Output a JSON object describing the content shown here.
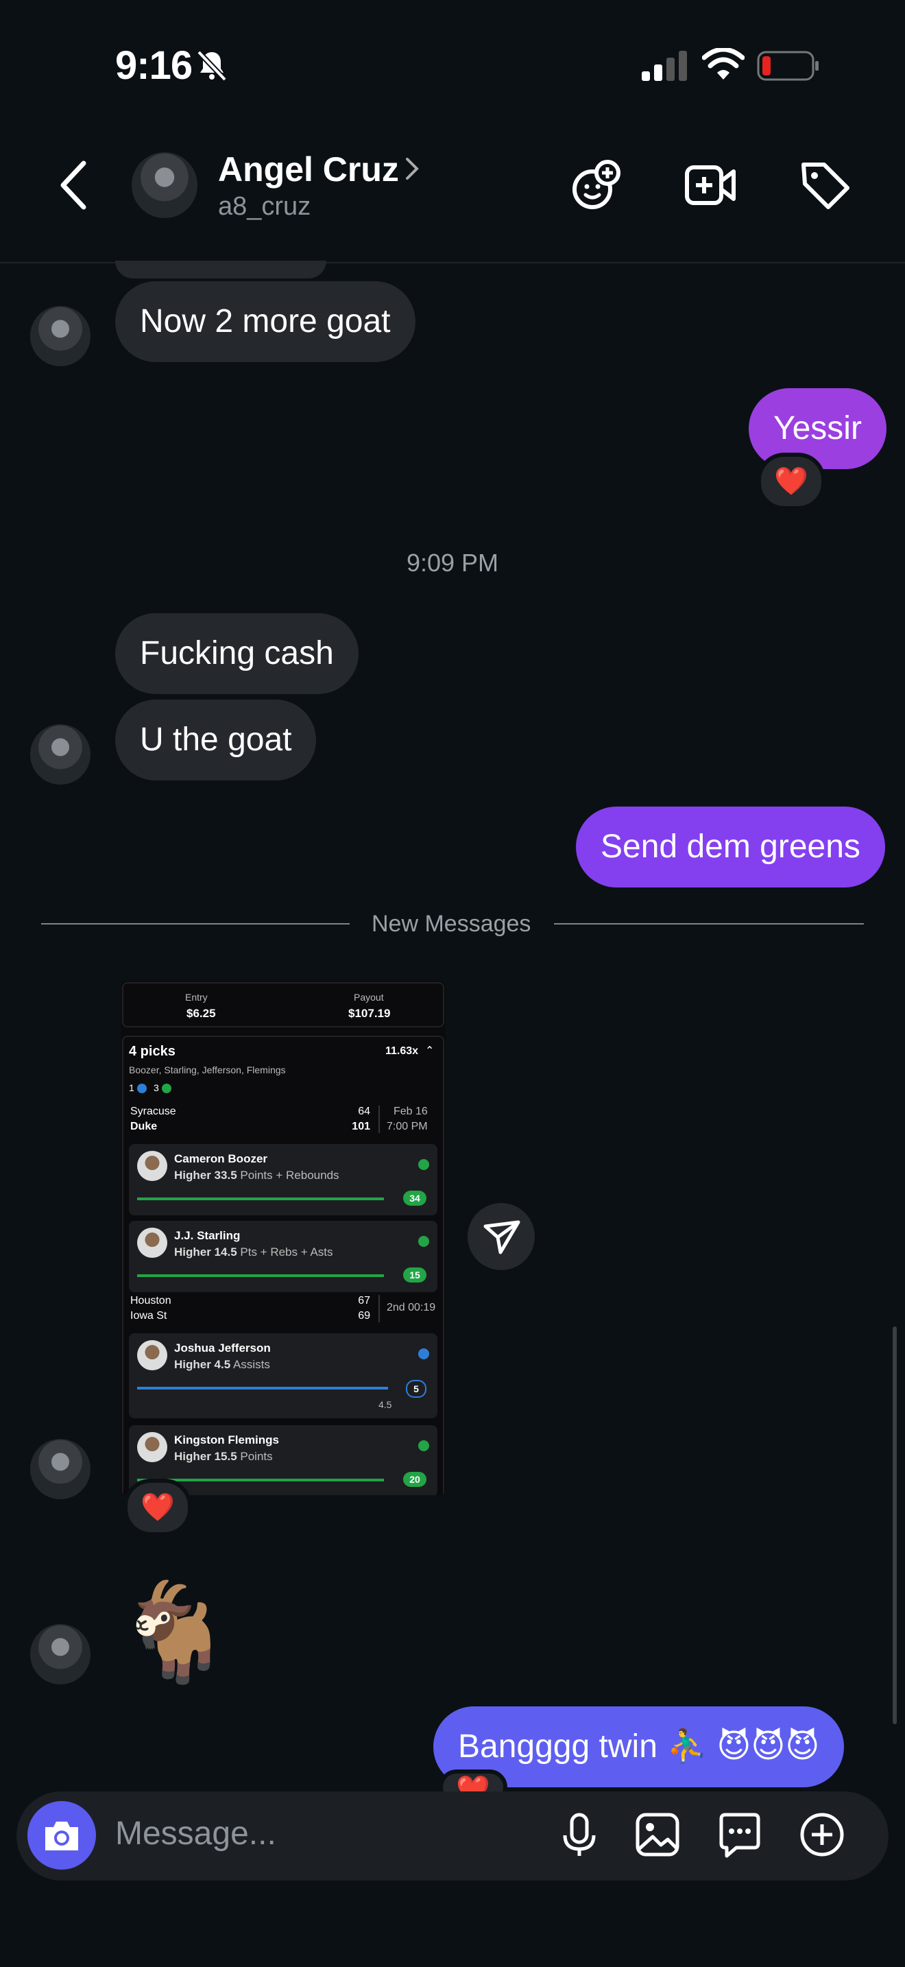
{
  "status": {
    "time": "9:16"
  },
  "header": {
    "name": "Angel Cruz",
    "username": "a8_cruz"
  },
  "messages": {
    "in_1": "Now 2 more goat",
    "out_1": "Yessir",
    "out_1_reaction": "❤️",
    "timestamp": "9:09 PM",
    "in_2": "Fucking cash",
    "in_3": "U the goat",
    "out_2": "Send dem greens",
    "divider": "New Messages",
    "image_reaction": "❤️",
    "in_emoji": "🐐",
    "out_3": "Bangggg twin ⛹️‍♂️ 😈😈😈",
    "out_3_reaction": "❤️"
  },
  "shared_screenshot": {
    "entry_label": "Entry",
    "entry_value": "$6.25",
    "payout_label": "Payout",
    "payout_value": "$107.19",
    "picks_title": "4 picks",
    "multiplier": "11.63x",
    "players_line": "Boozer, Starling, Jefferson, Flemings",
    "status_counts": [
      "1",
      "3"
    ],
    "game1": {
      "team_a": "Syracuse",
      "team_b": "Duke",
      "score_a": "64",
      "score_b": "101",
      "date": "Feb 16",
      "time": "7:00 PM"
    },
    "pick1": {
      "name": "Cameron Boozer",
      "line": "Higher 33.5",
      "stat": "Points + Rebounds",
      "result": "34"
    },
    "pick2": {
      "name": "J.J. Starling",
      "line": "Higher 14.5",
      "stat": "Pts + Rebs + Asts",
      "result": "15"
    },
    "game2": {
      "team_a": "Houston",
      "team_b": "Iowa St",
      "score_a": "67",
      "score_b": "69",
      "clock": "2nd 00:19"
    },
    "pick3": {
      "name": "Joshua Jefferson",
      "line": "Higher 4.5",
      "stat": "Assists",
      "result": "5",
      "marker": "4.5"
    },
    "pick4": {
      "name": "Kingston Flemings",
      "line": "Higher 15.5",
      "stat": "Points",
      "result": "20"
    }
  },
  "composer": {
    "placeholder": "Message..."
  },
  "colors": {
    "outgoing": "#9b3fe0",
    "incoming": "#25282d",
    "accent": "#5b5bf0",
    "background": "#0b1015"
  },
  "icons": [
    "bell-slash-icon",
    "signal-icon",
    "wifi-icon",
    "battery-icon",
    "back-icon",
    "sticker-add-icon",
    "video-add-icon",
    "tag-icon",
    "send-icon",
    "camera-icon",
    "mic-icon",
    "gallery-icon",
    "chat-options-icon",
    "plus-icon"
  ]
}
